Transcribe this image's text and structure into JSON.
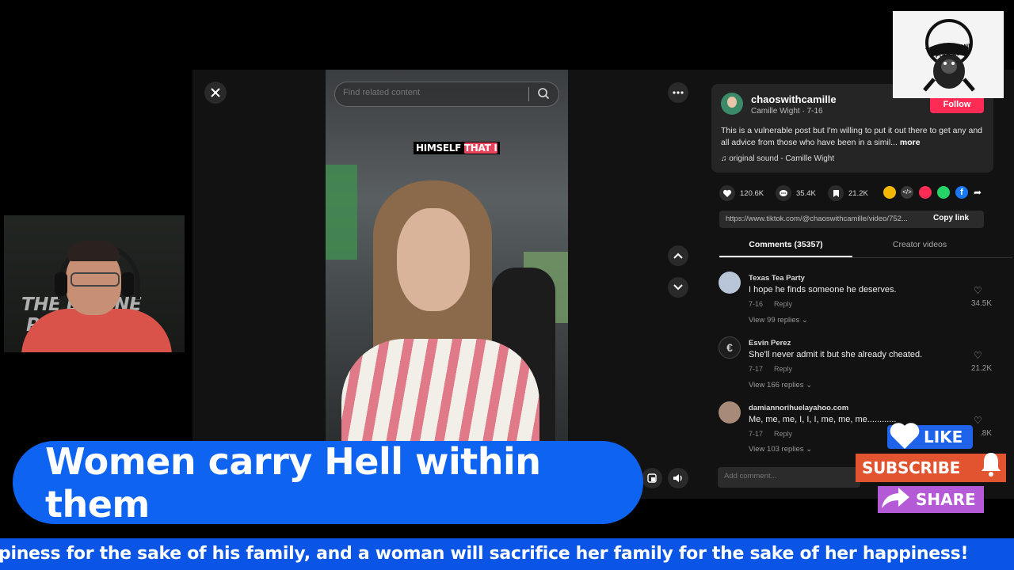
{
  "search": {
    "placeholder": "Find related content"
  },
  "video": {
    "caption_part1": "HIMSELF ",
    "caption_part2": "THAT I"
  },
  "post": {
    "username": "chaoswithcamille",
    "display_name_date": "Camille Wight · 7-16",
    "follow_label": "Follow",
    "description": "This is a vulnerable post but I'm willing to put it out there to get any and all advice from those who have been in a simil...",
    "more_label": "more",
    "sound": "original sound - Camille Wight"
  },
  "stats": {
    "likes": "120.6K",
    "comments": "35.4K",
    "saves": "21.2K"
  },
  "share_icons": [
    {
      "name": "embed-icon",
      "color": "#f2b705"
    },
    {
      "name": "code-icon",
      "color": "#3a3a3a"
    },
    {
      "name": "send-icon",
      "color": "#fe2c55"
    },
    {
      "name": "whatsapp-icon",
      "color": "#25d366"
    },
    {
      "name": "facebook-icon",
      "color": "#1877f2"
    },
    {
      "name": "forward-icon",
      "color": "#2b2b2b"
    }
  ],
  "link": {
    "url": "https://www.tiktok.com/@chaoswithcamille/video/752...",
    "copy_label": "Copy link"
  },
  "tabs": {
    "comments": "Comments (35357)",
    "creator": "Creator videos"
  },
  "comments": [
    {
      "name": "Texas Tea Party",
      "text": "I hope he finds someone he deserves.",
      "date": "7-16",
      "reply": "Reply",
      "views": "View 99 replies",
      "likes": "34.5K"
    },
    {
      "name": "Esvin Perez",
      "text": "She'll never admit it but she already cheated.",
      "date": "7-17",
      "reply": "Reply",
      "views": "View 166 replies",
      "likes": "21.2K"
    },
    {
      "name": "damiannorihuelayahoo.com",
      "text": "Me, me, me, I, I, I, me, me, me............",
      "date": "7-17",
      "reply": "Reply",
      "views": "View 103 replies",
      "likes": ".8K"
    }
  ],
  "add_comment": {
    "placeholder": "Add comment..."
  },
  "logo": {
    "text": "THE BACKBONE PODCAST"
  },
  "webcam": {
    "wall_text_1": "THE B   BONE",
    "wall_text_2": "P"
  },
  "overlay": {
    "title": "Women carry Hell within them",
    "ticker": "piness for the sake of his family, and a woman will sacrifice her family for the sake of her happiness!"
  },
  "cta": {
    "like": "LIKE",
    "subscribe": "SUBSCRIBE",
    "share": "SHARE"
  },
  "colors": {
    "accent_blue": "#0e64f0",
    "tiktok_red": "#fe2c55",
    "subscribe_orange": "#e1542f",
    "share_purple": "#b45ad6"
  }
}
